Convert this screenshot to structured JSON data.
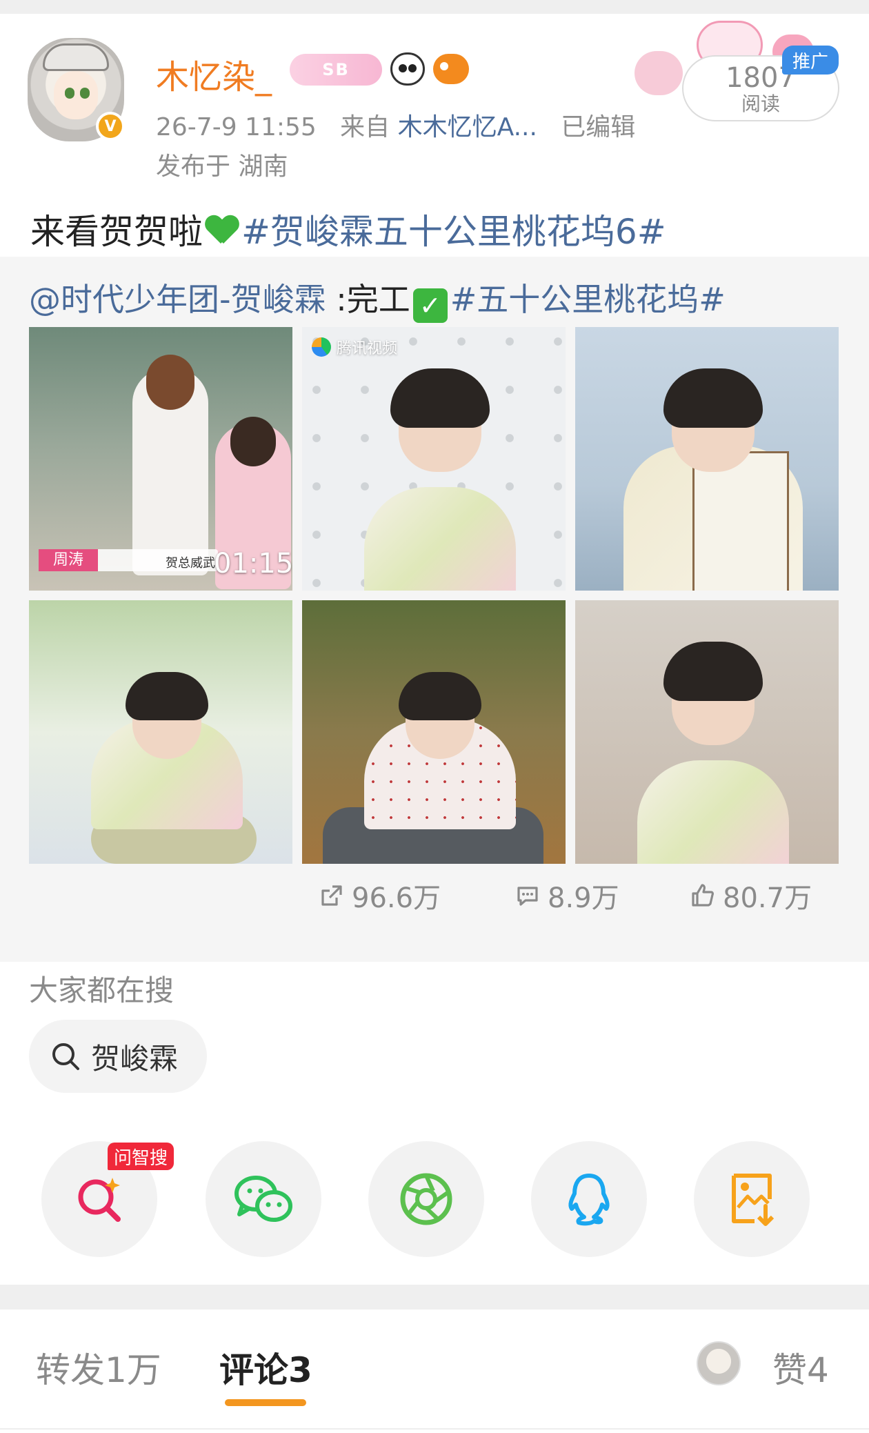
{
  "post": {
    "username": "木忆染_",
    "badge_text": "SB",
    "timestamp": "26-7-9 11:55",
    "source_prefix": "来自",
    "source": "木木忆忆A...",
    "edited": "已编辑",
    "location": "发布于 湖南",
    "reads": {
      "count": "1807",
      "label": "阅读"
    },
    "promo_label": "推广",
    "text_plain": "来看贺贺啦",
    "text_tag": "#贺峻霖五十公里桃花坞6#"
  },
  "retweet": {
    "mention": "@时代少年团-贺峻霖",
    "plain": " :完工",
    "tag": "#五十公里桃花坞#",
    "video": {
      "name_caption": "周涛",
      "caption_text": "贺总威武",
      "duration": "01:15"
    },
    "watermark": "腾讯视频",
    "stats": {
      "forwards": "96.6万",
      "comments": "8.9万",
      "likes": "80.7万"
    }
  },
  "search": {
    "title": "大家都在搜",
    "chip": "贺峻霖"
  },
  "share": {
    "ai_tag": "问智搜",
    "icons": [
      "ai-search-icon",
      "wechat-icon",
      "moments-icon",
      "qq-icon",
      "save-image-icon"
    ]
  },
  "tabs": {
    "forward": "转发1万",
    "comment": "评论3",
    "like": "赞4"
  },
  "colors": {
    "username": "#f07c22",
    "link": "#4a6b9a",
    "accent": "#f3961f",
    "promo": "#3a8ce6",
    "ai_tag": "#f0283a"
  }
}
